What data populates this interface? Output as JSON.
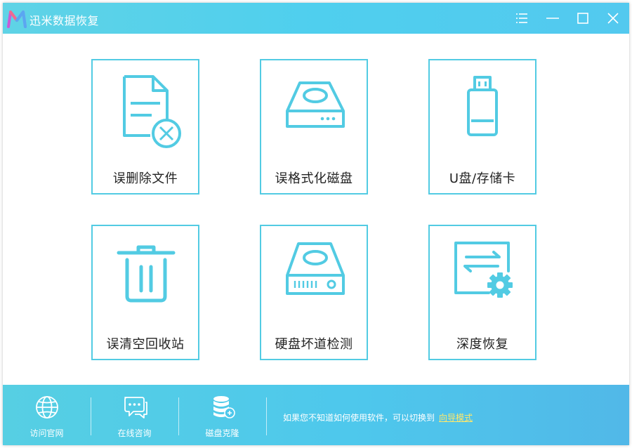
{
  "titlebar": {
    "title": "迅米数据恢复",
    "buttons": [
      "menu-icon",
      "minimize-icon",
      "maximize-icon",
      "close-icon"
    ]
  },
  "tiles": [
    {
      "label": "误删除文件",
      "icon": "deleted-file-icon"
    },
    {
      "label": "误格式化磁盘",
      "icon": "hard-drive-icon"
    },
    {
      "label": "U盘/存储卡",
      "icon": "usb-drive-icon"
    },
    {
      "label": "误清空回收站",
      "icon": "trash-bin-icon"
    },
    {
      "label": "硬盘坏道检测",
      "icon": "drive-scan-icon"
    },
    {
      "label": "深度恢复",
      "icon": "deep-recovery-icon"
    }
  ],
  "footer": {
    "items": [
      {
        "label": "访问官网",
        "icon": "globe-icon"
      },
      {
        "label": "在线咨询",
        "icon": "chat-icon"
      },
      {
        "label": "磁盘克隆",
        "icon": "database-clone-icon"
      }
    ],
    "hint_text": "如果您不知道如何使用软件，可以切换到",
    "hint_link": "向导模式"
  },
  "colors": {
    "accent": "#52cbe3",
    "title_bar": "#4fcfee",
    "footer_bar": "#4ec8ec",
    "link": "#ffe86a"
  }
}
